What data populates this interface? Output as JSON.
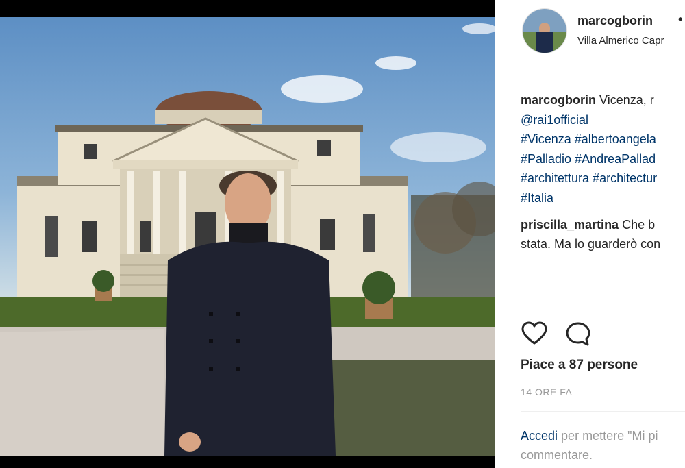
{
  "post": {
    "username": "marcogborin",
    "separator": "•",
    "location": "Villa Almerico Capr",
    "caption": {
      "user": "marcogborin",
      "text": "Vicenza, r",
      "lines": [
        "@rai1official",
        "#Vicenza #albertoangela",
        "#Palladio #AndreaPallad",
        "#architettura #architectur",
        "#Italia"
      ]
    },
    "comment": {
      "user": "priscilla_martina",
      "text_line1": "Che b",
      "text_line2": "stata. Ma lo guarderò con"
    },
    "likes": "Piace a 87 persone",
    "timestamp": "14 ORE FA",
    "login": {
      "link": "Accedi",
      "text_line1": "per mettere \"Mi pi",
      "text_line2": "commentare."
    }
  },
  "icons": {
    "like": "heart-icon",
    "comment": "comment-icon"
  },
  "colors": {
    "text": "#262626",
    "link": "#003569",
    "muted": "#999999",
    "background": "#000000"
  }
}
